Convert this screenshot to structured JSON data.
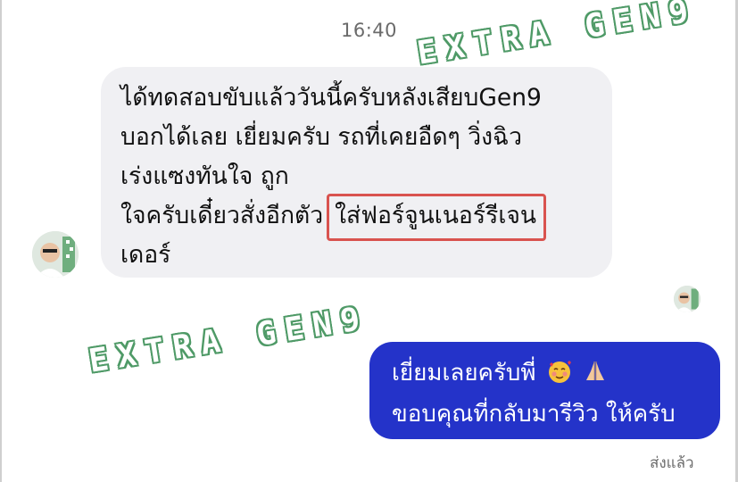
{
  "chat": {
    "timestamp": "16:40",
    "incoming": {
      "line1": "ได้ทดสอบขับแล้ววันนี้ครับหลังเสียบGen9",
      "line2": "บอกได้เลย เยี่ยมครับ  รถที่เคยอืดๆ วิ่งฉิว",
      "line3": "เร่งแซงทันใจ ถูก",
      "line4_plain": "ใจครับเดี๋ยวสั่งอีกตัว",
      "line4_highlight": "ใส่ฟอร์จูนเนอร์รีเจน",
      "line5": "เดอร์"
    },
    "outgoing": {
      "line1": "เยี่ยมเลยครับพี่",
      "line2": "ขอบคุณที่กลับมารีวิว ให้ครับ",
      "emojis": [
        "smiling-face-with-hearts",
        "folded-hands"
      ]
    },
    "status": "ส่งแล้ว"
  },
  "watermark": {
    "top": "EXTRA GEN9",
    "bottom": "EXTRA GEN9"
  },
  "colors": {
    "incoming_bubble": "#f0f0f3",
    "outgoing_bubble": "#2433c9",
    "highlight_border": "#d9534f",
    "watermark_outline": "#4f9a67"
  }
}
